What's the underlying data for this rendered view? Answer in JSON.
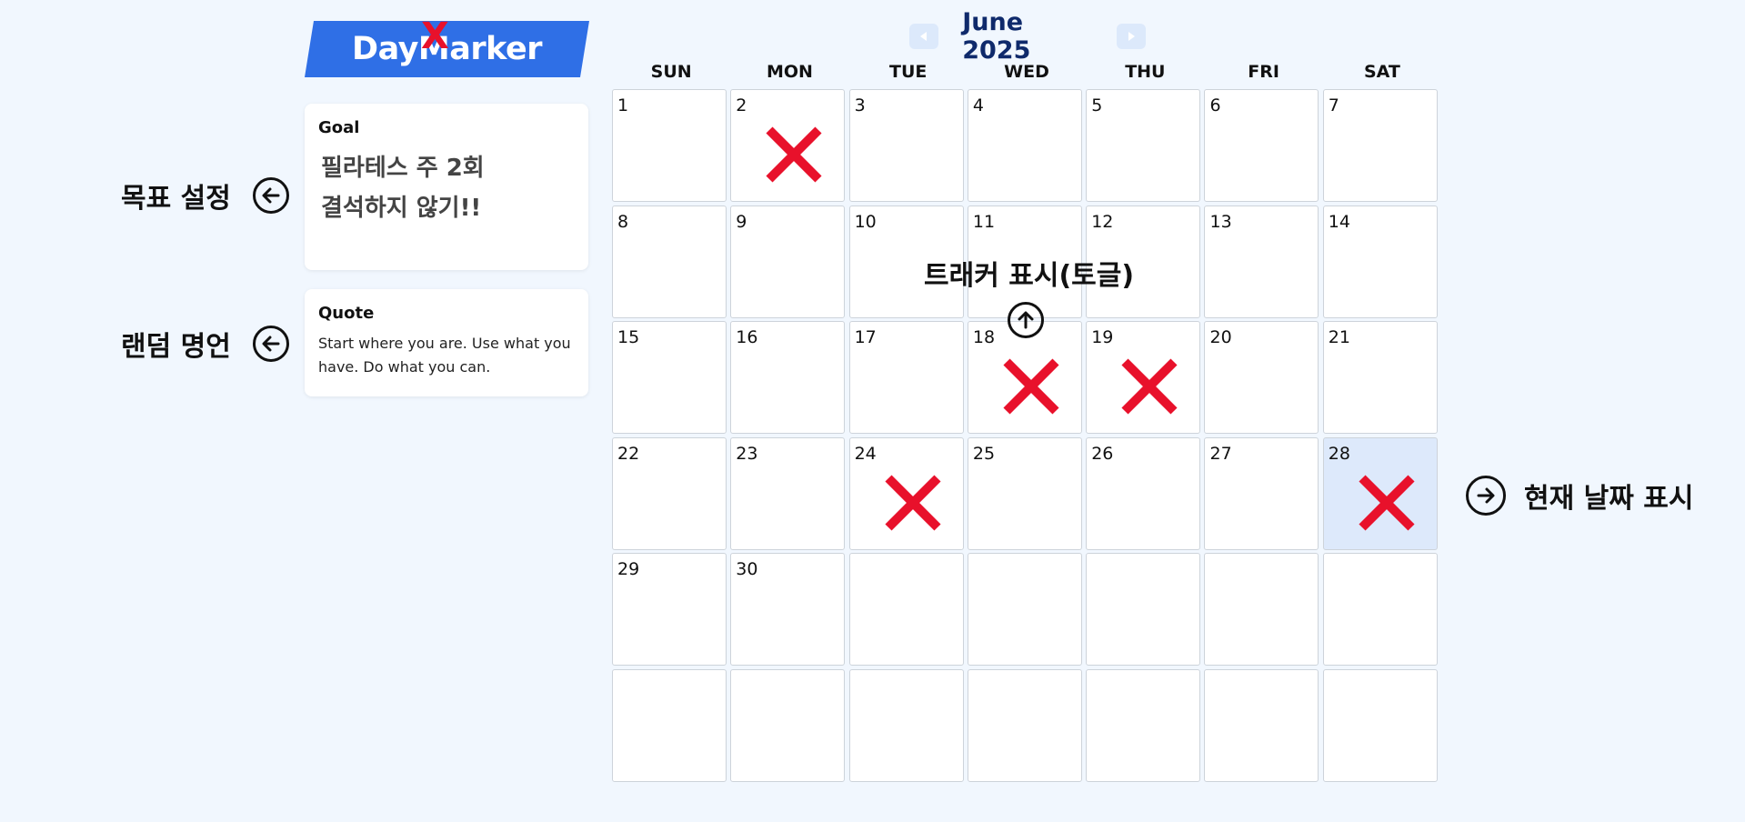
{
  "logo": {
    "text": "DayMarker",
    "mark": "X"
  },
  "goal": {
    "title": "Goal",
    "line1": "필라테스 주 2회",
    "line2": "결석하지 않기!!"
  },
  "quote": {
    "title": "Quote",
    "text": "Start where you are. Use what you have. Do what you can."
  },
  "annotations": {
    "goal": "목표 설정",
    "quote": "랜덤 명언",
    "tracker": "트래커 표시(토글)",
    "today": "현재 날짜 표시"
  },
  "calendar": {
    "month_title": "June 2025",
    "prev_icon": "triangle-left-icon",
    "next_icon": "triangle-right-icon",
    "weekdays": [
      "SUN",
      "MON",
      "TUE",
      "WED",
      "THU",
      "FRI",
      "SAT"
    ],
    "days": [
      "1",
      "2",
      "3",
      "4",
      "5",
      "6",
      "7",
      "8",
      "9",
      "10",
      "11",
      "12",
      "13",
      "14",
      "15",
      "16",
      "17",
      "18",
      "19",
      "20",
      "21",
      "22",
      "23",
      "24",
      "25",
      "26",
      "27",
      "28",
      "29",
      "30",
      "",
      "",
      "",
      "",
      "",
      "",
      "",
      "",
      "",
      "",
      "",
      ""
    ],
    "marked_days": [
      "2",
      "18",
      "19",
      "24",
      "28"
    ],
    "today": "28",
    "mark_color": "#e8112b",
    "today_color": "#dde9fb"
  }
}
